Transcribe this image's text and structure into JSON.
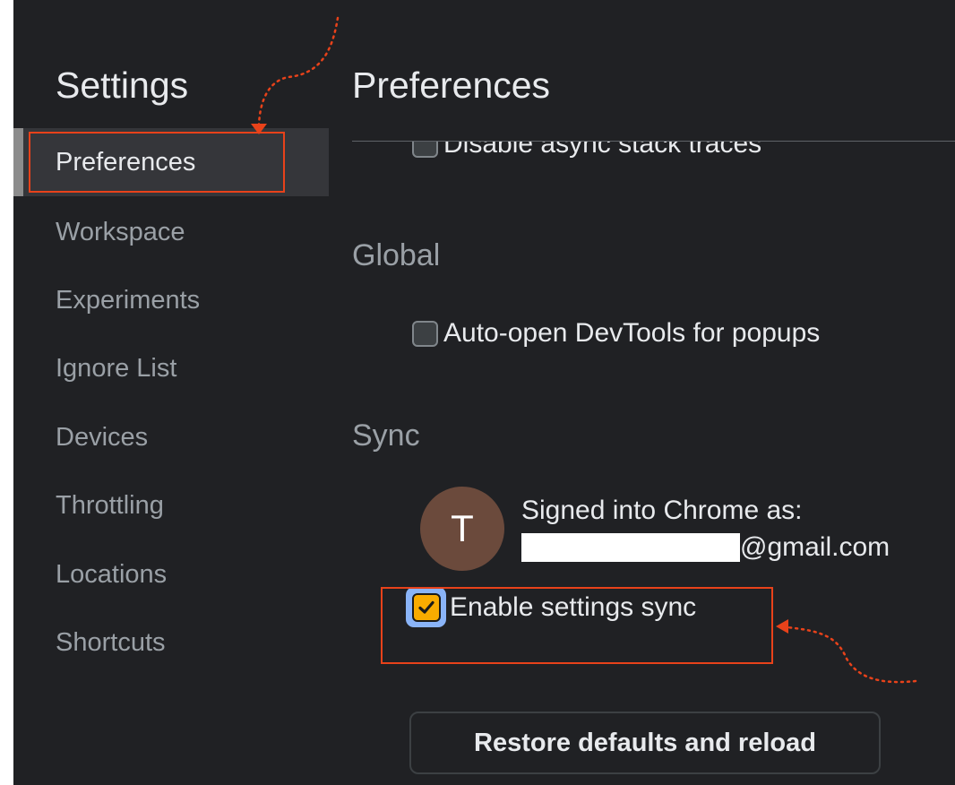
{
  "sidebar": {
    "title": "Settings",
    "items": [
      {
        "label": "Preferences"
      },
      {
        "label": "Workspace"
      },
      {
        "label": "Experiments"
      },
      {
        "label": "Ignore List"
      },
      {
        "label": "Devices"
      },
      {
        "label": "Throttling"
      },
      {
        "label": "Locations"
      },
      {
        "label": "Shortcuts"
      }
    ]
  },
  "main": {
    "title": "Preferences",
    "async_stack_traces": {
      "label": "Disable async stack traces",
      "checked": false
    },
    "global": {
      "title": "Global",
      "auto_open": {
        "label": "Auto-open DevTools for popups",
        "checked": false
      }
    },
    "sync": {
      "title": "Sync",
      "avatar_letter": "T",
      "signed_in_label": "Signed into Chrome as:",
      "email_visible": "@gmail.com",
      "enable_sync": {
        "label": "Enable settings sync",
        "checked": true
      }
    },
    "restore_button": "Restore defaults and reload"
  },
  "colors": {
    "background": "#202124",
    "active_item": "#35363a",
    "checkbox_checked": "#f9ab00",
    "focus_ring": "#8ab4f8",
    "annotation": "#e8421a"
  }
}
